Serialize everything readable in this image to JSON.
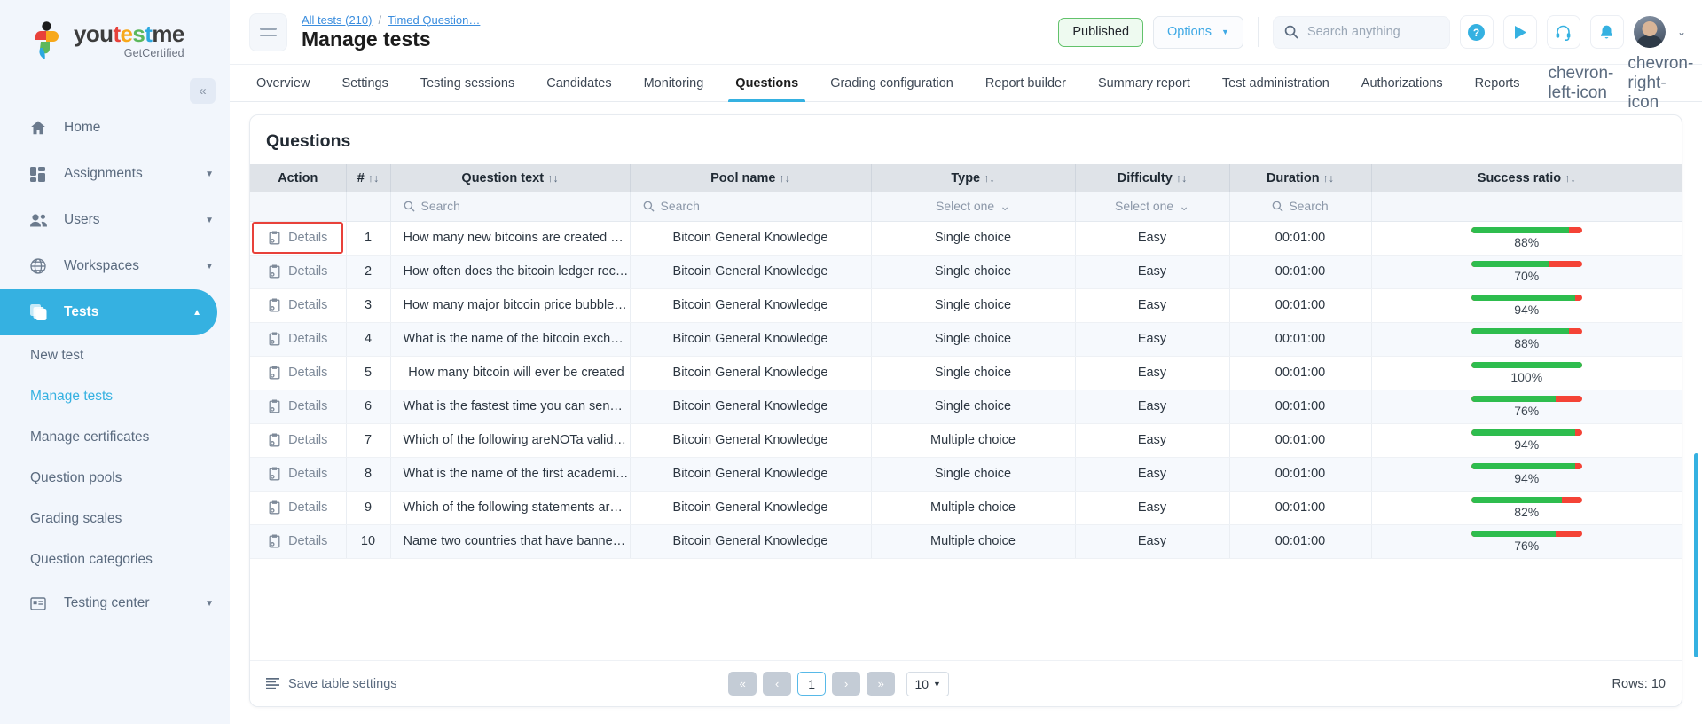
{
  "brand": {
    "name_parts": [
      "you",
      "t",
      "e",
      "s",
      "t",
      "me"
    ],
    "tagline": "GetCertified",
    "collapse_icon": "chevrons-left-icon"
  },
  "sidebar": {
    "items": [
      {
        "label": "Home",
        "icon": "home-icon",
        "expandable": false,
        "active": false
      },
      {
        "label": "Assignments",
        "icon": "assignments-icon",
        "expandable": true,
        "active": false
      },
      {
        "label": "Users",
        "icon": "users-icon",
        "expandable": true,
        "active": false
      },
      {
        "label": "Workspaces",
        "icon": "globe-icon",
        "expandable": true,
        "active": false
      },
      {
        "label": "Tests",
        "icon": "tests-icon",
        "expandable": true,
        "active": true
      }
    ],
    "sub_items": [
      {
        "label": "New test",
        "current": false
      },
      {
        "label": "Manage tests",
        "current": true
      },
      {
        "label": "Manage certificates",
        "current": false
      },
      {
        "label": "Question pools",
        "current": false
      },
      {
        "label": "Grading scales",
        "current": false
      },
      {
        "label": "Question categories",
        "current": false
      }
    ],
    "bottom_item": {
      "label": "Testing center",
      "icon": "testing-center-icon"
    }
  },
  "topbar": {
    "menu_icon": "hamburger-icon",
    "breadcrumb": {
      "root": "All tests (210)",
      "separator": "/",
      "current": "Timed Question…"
    },
    "title": "Manage tests",
    "status_label": "Published",
    "options_label": "Options",
    "options_caret": "chevron-down-icon",
    "search_placeholder": "Search anything",
    "search_icon": "search-icon",
    "actions": [
      {
        "name": "help-icon",
        "glyph": "?"
      },
      {
        "name": "play-icon",
        "glyph": "▶"
      },
      {
        "name": "headset-icon",
        "glyph": "headset"
      },
      {
        "name": "bell-icon",
        "glyph": "bell"
      }
    ],
    "avatar_caret": "chevron-down-icon"
  },
  "tabs": {
    "items": [
      "Overview",
      "Settings",
      "Testing sessions",
      "Candidates",
      "Monitoring",
      "Questions",
      "Grading configuration",
      "Report builder",
      "Summary report",
      "Test administration",
      "Authorizations",
      "Reports"
    ],
    "active": "Questions",
    "prev_icon": "chevron-left-icon",
    "next_icon": "chevron-right-icon"
  },
  "table": {
    "title": "Questions",
    "columns": [
      {
        "label": "Action",
        "sortable": false
      },
      {
        "label": "#",
        "sortable": true
      },
      {
        "label": "Question text",
        "sortable": true
      },
      {
        "label": "Pool name",
        "sortable": true
      },
      {
        "label": "Type",
        "sortable": true
      },
      {
        "label": "Difficulty",
        "sortable": true
      },
      {
        "label": "Duration",
        "sortable": true
      },
      {
        "label": "Success ratio",
        "sortable": true
      }
    ],
    "sort_glyph": "↑↓",
    "filters": {
      "action": "",
      "number": "",
      "question_text": "Search",
      "pool_name": "Search",
      "type": "Select one",
      "difficulty": "Select one",
      "duration": "Search",
      "success_ratio": ""
    },
    "action_label": "Details",
    "action_icon": "details-clipboard-icon",
    "rows": [
      {
        "num": "1",
        "question": "How many new bitcoins are created each …",
        "pool": "Bitcoin General Knowledge",
        "type": "Single choice",
        "difficulty": "Easy",
        "duration": "00:01:00",
        "ratio": 88,
        "ratio_label": "88%",
        "highlighted": true
      },
      {
        "num": "2",
        "question": "How often does the bitcoin ledger reconc…",
        "pool": "Bitcoin General Knowledge",
        "type": "Single choice",
        "difficulty": "Easy",
        "duration": "00:01:00",
        "ratio": 70,
        "ratio_label": "70%",
        "highlighted": false
      },
      {
        "num": "3",
        "question": "How many major bitcoin price bubbles ha…",
        "pool": "Bitcoin General Knowledge",
        "type": "Single choice",
        "difficulty": "Easy",
        "duration": "00:01:00",
        "ratio": 94,
        "ratio_label": "94%",
        "highlighted": false
      },
      {
        "num": "4",
        "question": "What is the name of the bitcoin exchange…",
        "pool": "Bitcoin General Knowledge",
        "type": "Single choice",
        "difficulty": "Easy",
        "duration": "00:01:00",
        "ratio": 88,
        "ratio_label": "88%",
        "highlighted": false
      },
      {
        "num": "5",
        "question": "How many bitcoin will ever be created",
        "pool": "Bitcoin General Knowledge",
        "type": "Single choice",
        "difficulty": "Easy",
        "duration": "00:01:00",
        "ratio": 100,
        "ratio_label": "100%",
        "highlighted": false
      },
      {
        "num": "6",
        "question": "What is the fastest time you can send or r…",
        "pool": "Bitcoin General Knowledge",
        "type": "Single choice",
        "difficulty": "Easy",
        "duration": "00:01:00",
        "ratio": 76,
        "ratio_label": "76%",
        "highlighted": false
      },
      {
        "num": "7",
        "question": "Which of the following areNOTa valid way…",
        "pool": "Bitcoin General Knowledge",
        "type": "Multiple choice",
        "difficulty": "Easy",
        "duration": "00:01:00",
        "ratio": 94,
        "ratio_label": "94%",
        "highlighted": false
      },
      {
        "num": "8",
        "question": "What is the name of the first academic p…",
        "pool": "Bitcoin General Knowledge",
        "type": "Single choice",
        "difficulty": "Easy",
        "duration": "00:01:00",
        "ratio": 94,
        "ratio_label": "94%",
        "highlighted": false
      },
      {
        "num": "9",
        "question": "Which of the following statements areNO…",
        "pool": "Bitcoin General Knowledge",
        "type": "Multiple choice",
        "difficulty": "Easy",
        "duration": "00:01:00",
        "ratio": 82,
        "ratio_label": "82%",
        "highlighted": false
      },
      {
        "num": "10",
        "question": "Name two countries that have banned th…",
        "pool": "Bitcoin General Knowledge",
        "type": "Multiple choice",
        "difficulty": "Easy",
        "duration": "00:01:00",
        "ratio": 76,
        "ratio_label": "76%",
        "highlighted": false
      }
    ],
    "footer": {
      "save_settings_label": "Save table settings",
      "save_settings_icon": "settings-list-icon",
      "first_icon": "«",
      "prev_icon": "‹",
      "current_page": "1",
      "next_icon": "›",
      "last_icon": "»",
      "page_size": "10",
      "page_size_caret": "chevron-down-icon",
      "rows_label": "Rows: 10"
    }
  },
  "colors": {
    "accent": "#35b1e1",
    "success": "#2ebd4e",
    "danger": "#f44336",
    "highlight_border": "#e8413a",
    "sidebar_bg": "#f2f6fc"
  }
}
